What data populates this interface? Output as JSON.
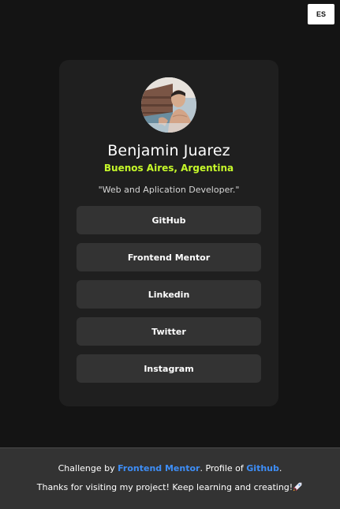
{
  "language_toggle": "ES",
  "profile": {
    "name": "Benjamin Juarez",
    "location": "Buenos Aires, Argentina",
    "bio": "\"Web and Aplication Developer.\""
  },
  "links": [
    "GitHub",
    "Frontend Mentor",
    "Linkedin",
    "Twitter",
    "Instagram"
  ],
  "footer": {
    "challenge_prefix": "Challenge by ",
    "frontend_mentor": "Frontend Mentor",
    "profile_of": ". Profile of ",
    "github": "Github",
    "period": ".",
    "thanks": "Thanks for visiting my project! Keep learning and creating!",
    "emoji_icon": "rocket-icon"
  },
  "colors": {
    "background": "#141414",
    "card": "#1f1f1f",
    "button": "#333333",
    "accent": "#c5f82a",
    "link": "#3e8ef7"
  }
}
